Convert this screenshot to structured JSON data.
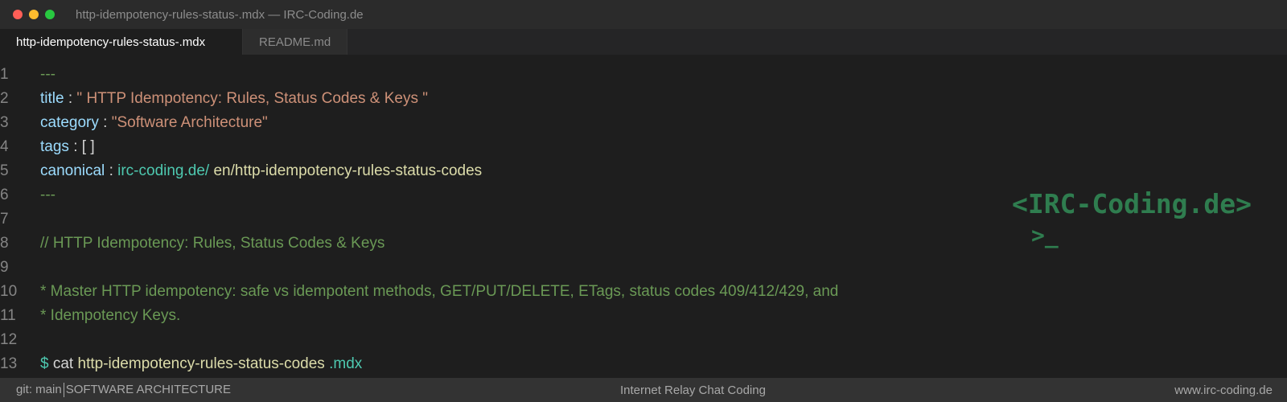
{
  "window": {
    "title": "http-idempotency-rules-status-.mdx — IRC-Coding.de"
  },
  "tabs": [
    {
      "label": "http-idempotency-rules-status-.mdx",
      "active": true
    },
    {
      "label": "README.md",
      "active": false
    }
  ],
  "editor": {
    "line_numbers": [
      "1",
      "2",
      "3",
      "4",
      "5",
      "6",
      "7",
      "8",
      "9",
      "10",
      "11",
      "12",
      "13"
    ],
    "lines": {
      "l1": "---",
      "l2_key": "title",
      "l2_colon": ":",
      "l2_value": "\" HTTP Idempotency: Rules, Status Codes & Keys \"",
      "l3_key": "category",
      "l3_colon": ":",
      "l3_value": "\"Software Architecture\"",
      "l4_key": "tags",
      "l4_colon": ":",
      "l4_value": "[ ]",
      "l5_key": "canonical",
      "l5_colon": ":",
      "l5_domain": "irc-coding.de/",
      "l5_path": "en/http-idempotency-rules-status-codes",
      "l6": "---",
      "l8": "// HTTP Idempotency: Rules, Status Codes & Keys",
      "l10": "* Master HTTP idempotency: safe vs idempotent methods, GET/PUT/DELETE, ETags, status codes 409/412/429, and",
      "l11": "* Idempotency Keys.",
      "l13_prompt": "$",
      "l13_cmd": "cat",
      "l13_file": "http-idempotency-rules-status-codes",
      "l13_ext": ".mdx"
    }
  },
  "logo": {
    "text": "<IRC-Coding.de>",
    "cursor": ">_"
  },
  "statusbar": {
    "branch": "git: main",
    "category": "SOFTWARE ARCHITECTURE",
    "center": "Internet Relay Chat Coding",
    "right": "www.irc-coding.de"
  }
}
